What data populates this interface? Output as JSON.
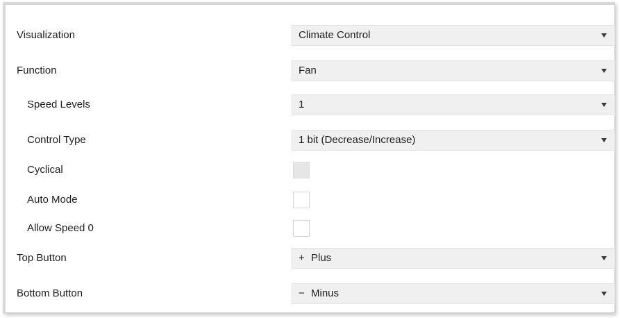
{
  "fields": {
    "visualization": {
      "label": "Visualization",
      "value": "Climate Control"
    },
    "function": {
      "label": "Function",
      "value": "Fan"
    },
    "speed_levels": {
      "label": "Speed Levels",
      "value": "1"
    },
    "control_type": {
      "label": "Control Type",
      "value": "1 bit (Decrease/Increase)"
    },
    "cyclical": {
      "label": "Cyclical",
      "checked": false,
      "disabled": true
    },
    "auto_mode": {
      "label": "Auto Mode",
      "checked": false
    },
    "allow_speed_0": {
      "label": "Allow Speed 0",
      "checked": false
    },
    "top_button": {
      "label": "Top Button",
      "prefix": "+",
      "value": "Plus"
    },
    "bottom_button": {
      "label": "Bottom Button",
      "prefix": "−",
      "value": "Minus"
    }
  }
}
